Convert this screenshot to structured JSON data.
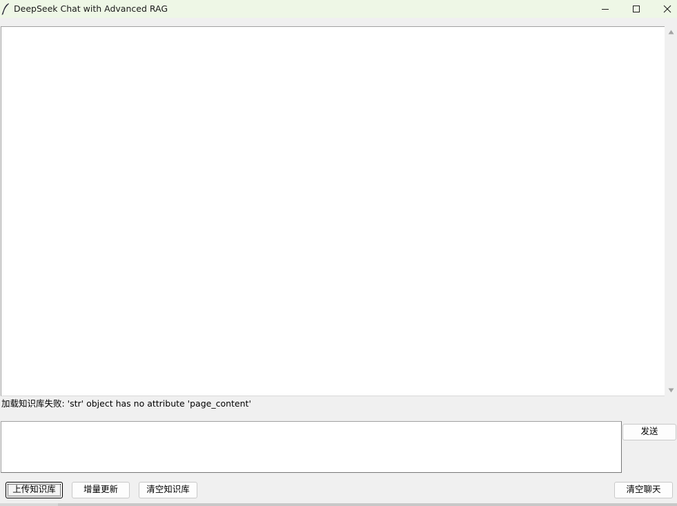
{
  "window": {
    "title": "DeepSeek Chat with Advanced RAG",
    "icon": "feather-icon",
    "controls": [
      "minimize-icon",
      "maximize-icon",
      "close-icon"
    ]
  },
  "chat": {
    "content": ""
  },
  "status": {
    "message": "加载知识库失败: 'str' object has no attribute 'page_content'"
  },
  "input": {
    "value": ""
  },
  "buttons": {
    "send": "发送",
    "upload_kb": "上传知识库",
    "incremental_update": "增量更新",
    "clear_kb": "清空知识库",
    "clear_chat": "清空聊天"
  }
}
